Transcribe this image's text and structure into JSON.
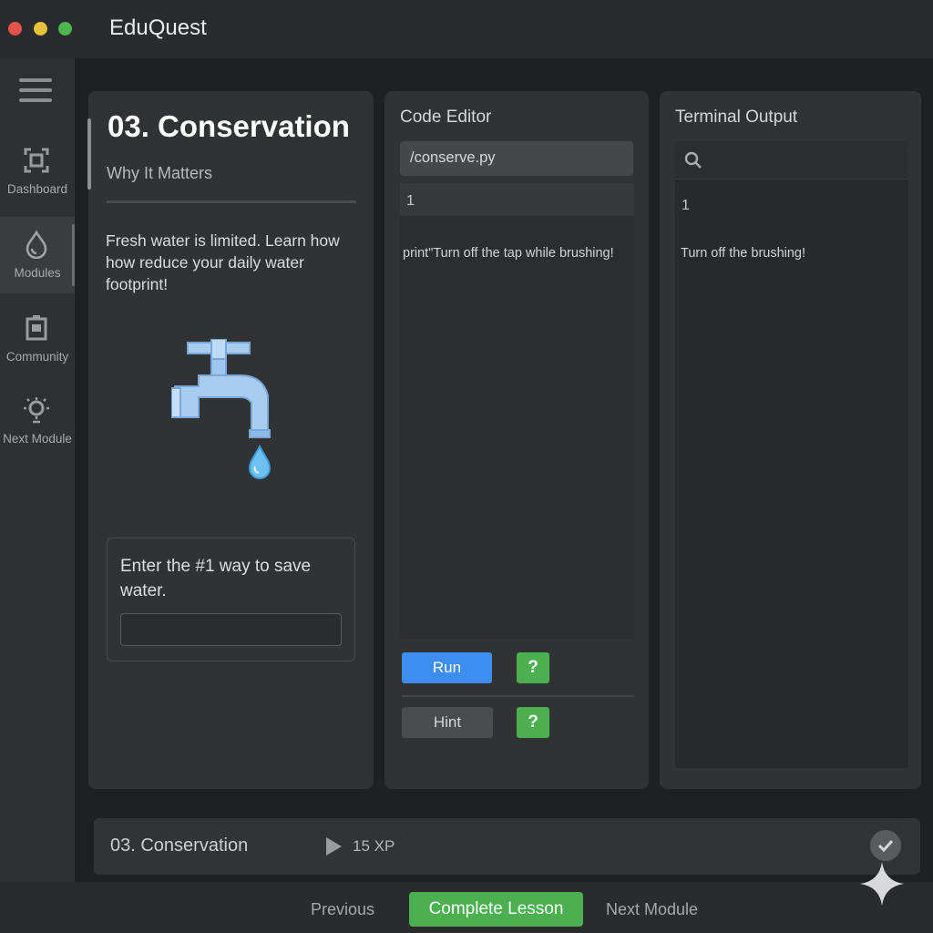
{
  "window": {
    "title": "EduQuest"
  },
  "sidebar": {
    "menu_icon": "hamburger-icon",
    "items": [
      {
        "label": "Dashboard",
        "icon": "dashboard-icon",
        "active": false
      },
      {
        "label": "Modules",
        "icon": "water-drop-icon",
        "active": true
      },
      {
        "label": "Community",
        "icon": "community-icon",
        "active": false
      },
      {
        "label": "Next Module",
        "icon": "lightbulb-icon",
        "active": false
      }
    ]
  },
  "lesson": {
    "title": "03. Conservation",
    "subtitle": "Why It Matters",
    "body": "Fresh water is limited. Learn how how reduce your daily water footprint!",
    "illustration": "faucet-icon",
    "prompt": "Enter the #1 way to save water.",
    "input_value": ""
  },
  "editor": {
    "heading": "Code Editor",
    "file": "/conserve.py",
    "line_number": "1",
    "code": "print\"Turn off the tap while brushing!",
    "run_label": "Run",
    "hint_label": "Hint",
    "help_label": "?"
  },
  "terminal": {
    "heading": "Terminal Output",
    "search_icon": "search-icon",
    "line_number": "1",
    "output": "Turn off the brushing!"
  },
  "progress": {
    "title": "03. Conservation",
    "xp": "15 XP"
  },
  "nav": {
    "previous": "Previous",
    "complete": "Complete Lesson",
    "next": "Next Module"
  },
  "colors": {
    "accent_blue": "#3d8ef0",
    "accent_green": "#4caf50",
    "background": "#1f2022",
    "panel": "#313234"
  }
}
